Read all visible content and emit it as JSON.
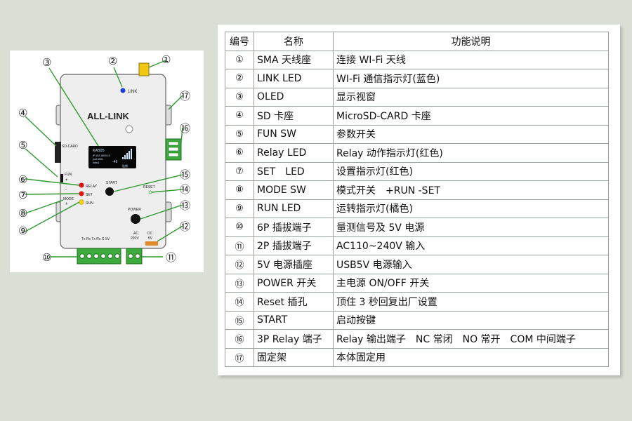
{
  "table": {
    "headers": [
      "编号",
      "名称",
      "功能说明"
    ],
    "rows": [
      {
        "num": "①",
        "name": "SMA 天线座",
        "desc": "连接 WI-Fi 天线"
      },
      {
        "num": "②",
        "name": "LINK LED",
        "desc": "WI-Fi 通信指示灯(蓝色)"
      },
      {
        "num": "③",
        "name": "OLED",
        "desc": "显示视窗"
      },
      {
        "num": "④",
        "name": "SD 卡座",
        "desc": "MicroSD-CARD 卡座"
      },
      {
        "num": "⑤",
        "name": "FUN SW",
        "desc": "参数开关"
      },
      {
        "num": "⑥",
        "name": "Relay LED",
        "desc": "Relay 动作指示灯(红色)"
      },
      {
        "num": "⑦",
        "name": "SET　LED",
        "desc": "设置指示灯(红色)"
      },
      {
        "num": "⑧",
        "name": "MODE SW",
        "desc": "模式开关　+RUN -SET"
      },
      {
        "num": "⑨",
        "name": "RUN LED",
        "desc": "运转指示灯(橘色)"
      },
      {
        "num": "⑩",
        "name": "6P 插拔端子",
        "desc": "量测信号及 5V 电源"
      },
      {
        "num": "⑪",
        "name": "2P 插拔端子",
        "desc": "AC110~240V 输入"
      },
      {
        "num": "⑫",
        "name": "5V 电源插座",
        "desc": "USB5V 电源输入"
      },
      {
        "num": "⑬",
        "name": "POWER 开关",
        "desc": "主电源 ON/OFF 开关"
      },
      {
        "num": "⑭",
        "name": "Reset 插孔",
        "desc": "顶住 3 秒回复出厂设置"
      },
      {
        "num": "⑮",
        "name": "START",
        "desc": "启动按键"
      },
      {
        "num": "⑯",
        "name": "3P Relay 端子",
        "desc": "Relay 输出端子　NC 常闭　NO 常开　COM 中间端子"
      },
      {
        "num": "⑰",
        "name": "固定架",
        "desc": "本体固定用"
      }
    ]
  },
  "device": {
    "brand": "ALL-LINK",
    "labels": {
      "link": "LINK",
      "sd_card": "SD-CARD",
      "fun": "FUN.",
      "mode": "MODE",
      "relay": "RELAY",
      "set": "SET",
      "run": "RUN",
      "start": "START",
      "reset": "RESET",
      "power": "POWER",
      "ac": "AC",
      "ac_v": "220V",
      "dc": "DC",
      "dc_v": "5V",
      "terminals": "Tx Rx Tx Rx  G  5V",
      "plus": "+",
      "minus": "-"
    },
    "oled": {
      "title": "KA505",
      "line1": "IP:192.168.5.10",
      "line2": "port:4001",
      "line3": "data:1",
      "signal": "-49",
      "state": "连线"
    },
    "callouts": [
      "①",
      "②",
      "③",
      "④",
      "⑤",
      "⑥",
      "⑦",
      "⑧",
      "⑨",
      "⑩",
      "⑪",
      "⑫",
      "⑬",
      "⑭",
      "⑮",
      "⑯",
      "⑰"
    ],
    "colors": {
      "link_led": "#1a3fd6",
      "relay_led": "#e01010",
      "set_led": "#e01010",
      "run_led": "#f2d21a",
      "terminal_green": "#3daa3d",
      "leader_green": "#2f9a2f",
      "antenna": "#f0c814"
    }
  }
}
